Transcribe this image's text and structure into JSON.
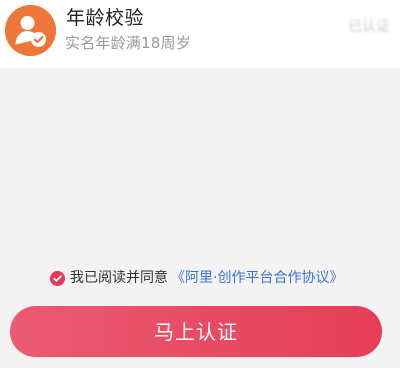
{
  "card": {
    "title": "年龄校验",
    "subtitle": "实名年龄满18周岁",
    "status": "已认证"
  },
  "agreement": {
    "text": "我已阅读并同意",
    "link": "《阿里·创作平台合作协议》"
  },
  "cta": {
    "label": "马上认证"
  },
  "colors": {
    "avatar": "#ee7638",
    "accent": "#e8355a",
    "link": "#3b74d6"
  },
  "icons": {
    "avatar": "user-verified-icon",
    "checkbox": "checkmark-icon"
  }
}
